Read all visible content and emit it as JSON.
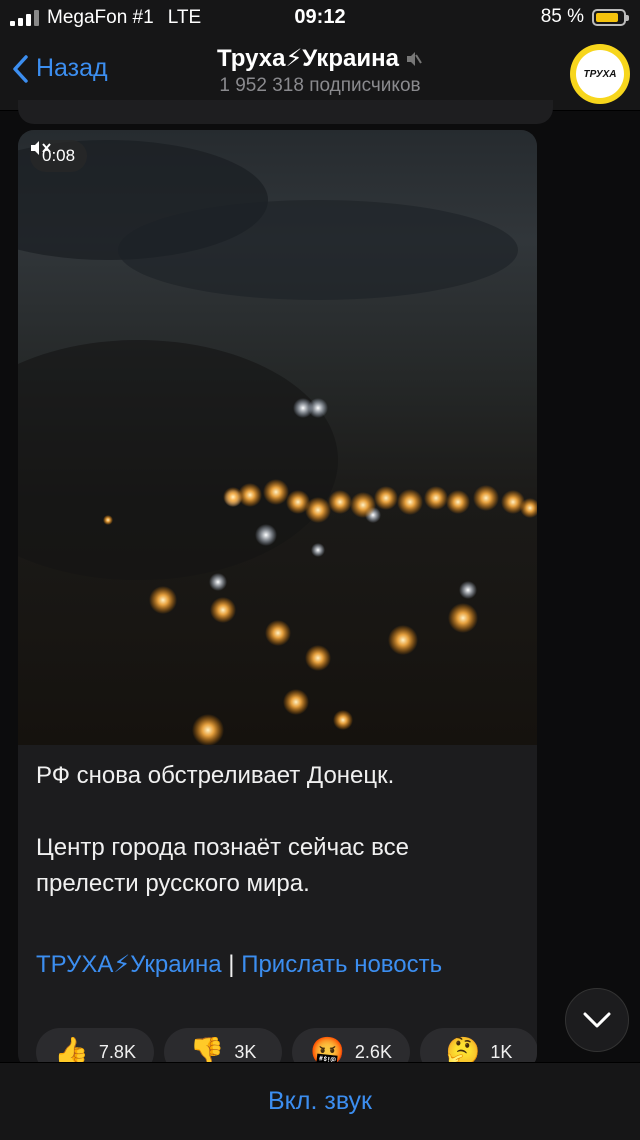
{
  "status_bar": {
    "carrier": "MegaFon #1",
    "network": "LTE",
    "time": "09:12",
    "battery_percent": "85 %",
    "battery_level": 0.85
  },
  "header": {
    "back_label": "Назад",
    "channel_title": "Труха⚡Украина",
    "subscribers": "1 952 318 подписчиков",
    "avatar_text": "ТРУХА",
    "muted_icon": "speaker-muted-icon"
  },
  "message": {
    "video_duration": "0:08",
    "text_line1": "РФ снова обстреливает Донецк.",
    "text_line2": "Центр города познаёт сейчас все прелести русского мира.",
    "link_channel": "ТРУХА⚡Украина",
    "link_separator": "|",
    "link_submit": "Прислать новость",
    "reactions": [
      {
        "emoji": "👍",
        "count": "7.8K"
      },
      {
        "emoji": "👎",
        "count": "3K"
      },
      {
        "emoji": "🤬",
        "count": "2.6K"
      },
      {
        "emoji": "🤔",
        "count": "1K"
      }
    ]
  },
  "bottom_bar": {
    "sound_button_label": "Вкл. звук"
  },
  "colors": {
    "accent": "#3c8ef0",
    "background": "#0c0c0d",
    "bubble": "#1c1c1e",
    "avatar_ring": "#f7d61c"
  }
}
